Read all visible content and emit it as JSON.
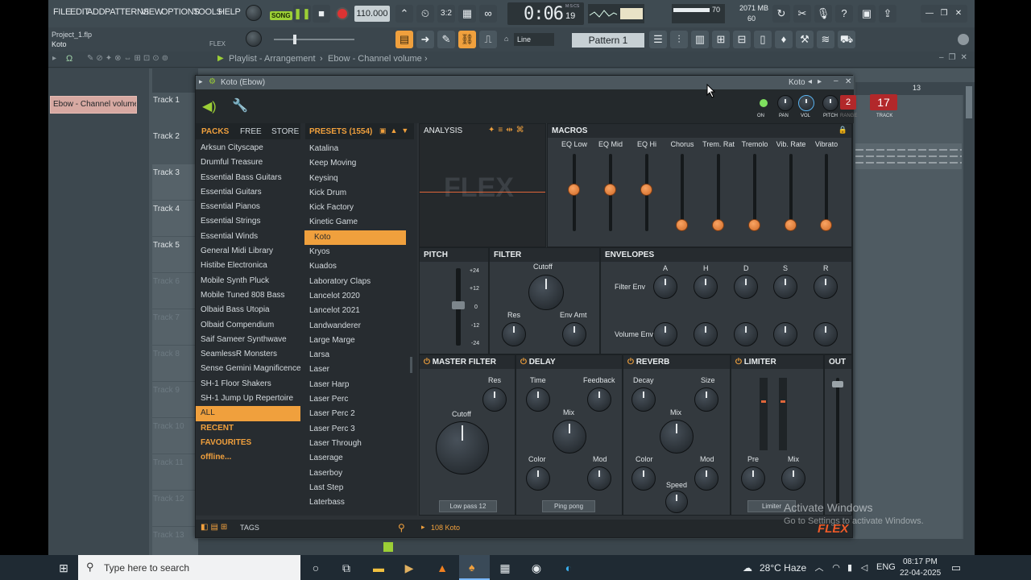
{
  "menu": [
    "FILE",
    "EDIT",
    "ADD",
    "PATTERNS",
    "VIEW",
    "OPTIONS",
    "TOOLS",
    "HELP"
  ],
  "transport": {
    "mode": "SONG",
    "tempo": "110.000",
    "time": "0:06",
    "time_frac": "19",
    "time_label": "M:S:CS",
    "memory": "2071 MB",
    "cpu": "70",
    "polyphony": "60"
  },
  "project": {
    "file": "Project_1.flp",
    "channel": "Koto",
    "preset_label": "FLEX"
  },
  "toolbar2": {
    "snap": "Line",
    "pattern": "Pattern 1"
  },
  "playlist": {
    "breadcrumb": "Playlist - Arrangement",
    "sep": "›",
    "item": "Ebow - Channel volume",
    "sep2": "›",
    "clip": "Ebow - Channel volume",
    "bar_marker": "13"
  },
  "tracks": [
    "Track 1",
    "Track 2",
    "Track 3",
    "Track 4",
    "Track 5",
    "Track 6",
    "Track 7",
    "Track 8",
    "Track 9",
    "Track 10",
    "Track 11",
    "Track 12",
    "Track 13"
  ],
  "plugin": {
    "title": "Koto (Ebow)",
    "title_right": "Koto",
    "head": {
      "on": "ON",
      "pan": "PAN",
      "vol": "VOL",
      "pitch": "PITCH",
      "range": "RANGE",
      "range_val": "2",
      "track": "TRACK",
      "track_val": "17"
    },
    "tabs": {
      "packs": "PACKS",
      "free": "FREE",
      "store": "STORE",
      "presets": "PRESETS (1554)",
      "analysis": "ANALYSIS",
      "macros": "MACROS"
    },
    "packs": [
      "Arksun Cityscape",
      "Drumful Treasure",
      "Essential Bass Guitars",
      "Essential Guitars",
      "Essential Pianos",
      "Essential Strings",
      "Essential Winds",
      "General Midi Library",
      "Histibe Electronica",
      "Mobile Synth Pluck",
      "Mobile Tuned 808 Bass",
      "Olbaid Bass Utopia",
      "Olbaid Compendium",
      "Saif Sameer Synthwave",
      "SeamlessR Monsters",
      "Sense Gemini Magnificence",
      "SH-1 Floor Shakers",
      "SH-1 Jump Up Repertoire"
    ],
    "pack_filters": [
      "ALL",
      "RECENT",
      "FAVOURITES",
      "offline..."
    ],
    "presets": [
      "Katalina",
      "Keep Moving",
      "Keysinq",
      "Kick Drum",
      "Kick Factory",
      "Kinetic Game",
      "Koto",
      "Kryos",
      "Kuados",
      "Laboratory Claps",
      "Lancelot 2020",
      "Lancelot 2021",
      "Landwanderer",
      "Large Marge",
      "Larsa",
      "Laser",
      "Laser Harp",
      "Laser Perc",
      "Laser Perc 2",
      "Laser Perc 3",
      "Laser Through",
      "Laserage",
      "Laserboy",
      "Last Step",
      "Laterbass"
    ],
    "macros": [
      {
        "name": "EQ Low",
        "level": 0.5
      },
      {
        "name": "EQ Mid",
        "level": 0.5
      },
      {
        "name": "EQ Hi",
        "level": 0.5
      },
      {
        "name": "Chorus",
        "level": 0
      },
      {
        "name": "Trem. Rat",
        "level": 0
      },
      {
        "name": "Tremolo",
        "level": 0
      },
      {
        "name": "Vib. Rate",
        "level": 0
      },
      {
        "name": "Vibrato",
        "level": 0
      }
    ],
    "pitch": {
      "title": "PITCH",
      "scale": [
        "+24",
        "+12",
        "0",
        "-12",
        "-24"
      ]
    },
    "filter": {
      "title": "FILTER",
      "cutoff": "Cutoff",
      "res": "Res",
      "env": "Env Amt"
    },
    "envelopes": {
      "title": "ENVELOPES",
      "cols": [
        "A",
        "H",
        "D",
        "S",
        "R"
      ],
      "rows": [
        "Filter Env",
        "Volume Env"
      ]
    },
    "master_filter": {
      "title": "MASTER FILTER",
      "res": "Res",
      "cutoff": "Cutoff",
      "mode": "Low pass 12"
    },
    "delay": {
      "title": "DELAY",
      "time": "Time",
      "feedback": "Feedback",
      "mix": "Mix",
      "color": "Color",
      "mod": "Mod",
      "mode": "Ping pong"
    },
    "reverb": {
      "title": "REVERB",
      "decay": "Decay",
      "size": "Size",
      "mix": "Mix",
      "color": "Color",
      "mod": "Mod",
      "speed": "Speed"
    },
    "limiter": {
      "title": "LIMITER",
      "pre": "Pre",
      "mix": "Mix",
      "mode": "Limiter"
    },
    "out": {
      "title": "OUT"
    },
    "footer": {
      "tags": "TAGS",
      "status": "108 Koto",
      "brand": "FLEX"
    },
    "analysis_logo": "FLEX"
  },
  "watermark": {
    "line1": "Activate Windows",
    "line2": "Go to Settings to activate Windows."
  },
  "taskbar": {
    "search_placeholder": "Type here to search",
    "weather": "28°C  Haze",
    "lang": "ENG",
    "time": "08:17 PM",
    "date": "22-04-2025"
  }
}
